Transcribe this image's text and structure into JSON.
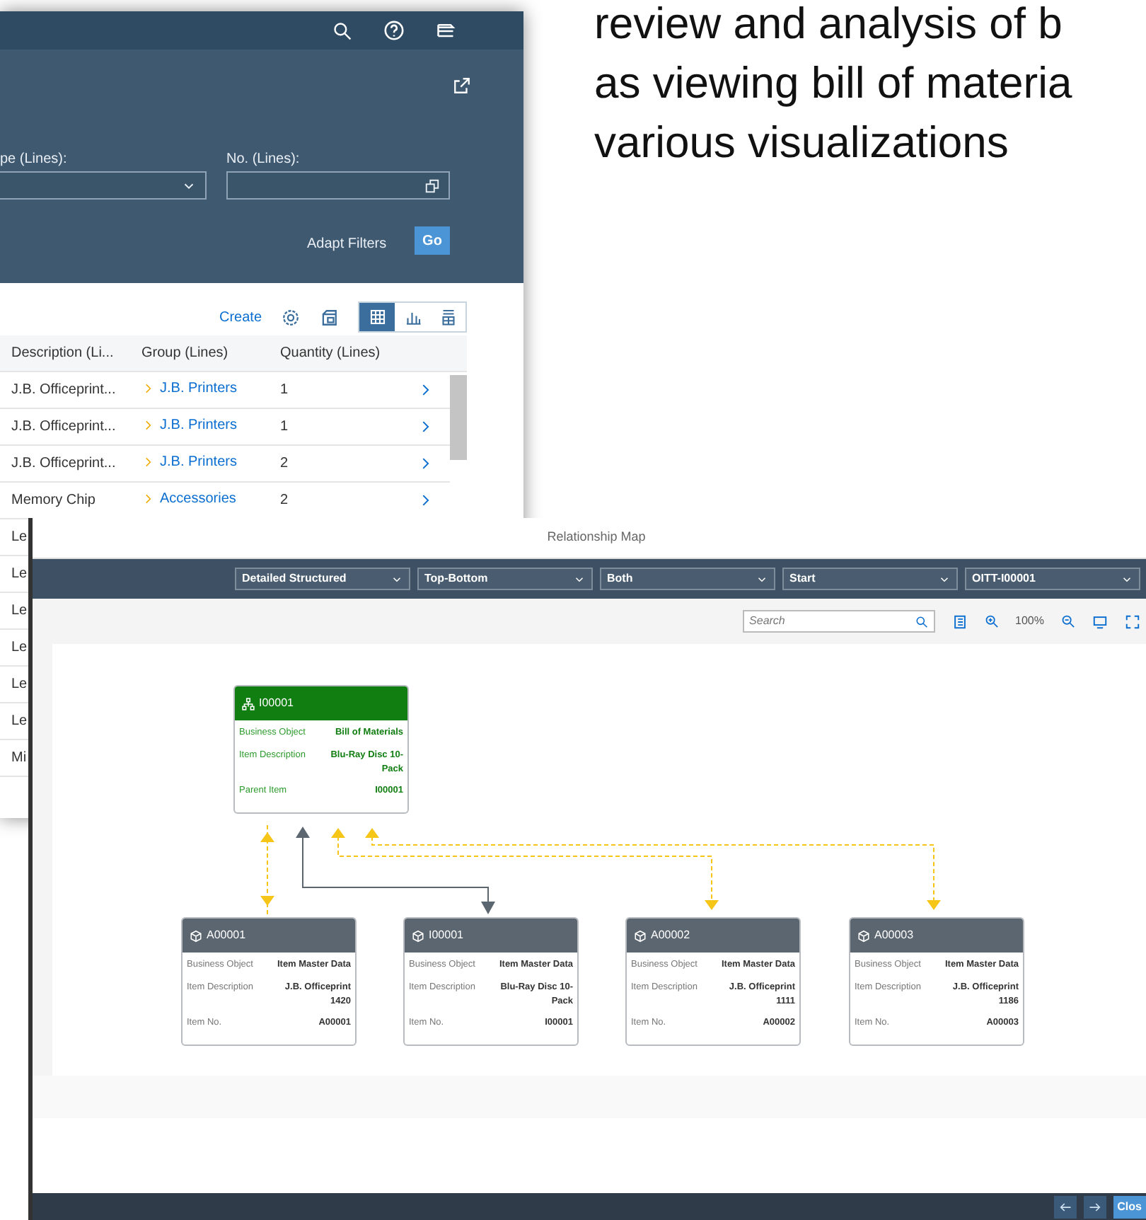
{
  "slide_text": [
    "review and analysis of b",
    "as viewing bill of materia",
    "various visualizations"
  ],
  "list_window": {
    "filters": [
      {
        "label": "pe (Lines):",
        "kind": "dropdown"
      },
      {
        "label": "No. (Lines):",
        "kind": "valuehelp"
      }
    ],
    "adapt_filters": "Adapt Filters",
    "go_button": "Go",
    "toolbar": {
      "create": "Create",
      "views": [
        {
          "kind": "table",
          "selected": true
        },
        {
          "kind": "chart",
          "selected": false
        },
        {
          "kind": "combined",
          "selected": false
        }
      ]
    },
    "table": {
      "columns": [
        "Description (Li...",
        "Group (Lines)",
        "Quantity (Lines)"
      ],
      "rows": [
        {
          "cells": [
            "J.B. Officeprint...",
            "J.B. Printers",
            "1"
          ]
        },
        {
          "cells": [
            "J.B. Officeprint...",
            "J.B. Printers",
            "1"
          ]
        },
        {
          "cells": [
            "J.B. Officeprint...",
            "J.B. Printers",
            "2"
          ]
        },
        {
          "cells": [
            "Memory Chip",
            "Accessories",
            "2"
          ]
        },
        {
          "cells": [
            "Le"
          ]
        },
        {
          "cells": [
            "Le"
          ]
        },
        {
          "cells": [
            "Le"
          ]
        },
        {
          "cells": [
            "Le"
          ]
        },
        {
          "cells": [
            "Le"
          ]
        },
        {
          "cells": [
            "Le"
          ]
        },
        {
          "cells": [
            "Mi"
          ]
        }
      ]
    }
  },
  "relationship_map": {
    "title": "Relationship Map",
    "dropdowns": [
      "Detailed Structured",
      "Top-Bottom",
      "Both",
      "Start",
      "OITT-I00001"
    ],
    "search": {
      "placeholder": "Search"
    },
    "zoom": "100%",
    "nodes": [
      {
        "kind": "bom",
        "title": "I00001",
        "fields": [
          {
            "label": "Business Object",
            "value": "Bill of Materials"
          },
          {
            "label": "Item Description",
            "value": "Blu-Ray Disc 10-Pack"
          },
          {
            "label": "Parent Item",
            "value": "I00001"
          }
        ]
      },
      {
        "kind": "item",
        "title": "A00001",
        "fields": [
          {
            "label": "Business Object",
            "value": "Item Master Data"
          },
          {
            "label": "Item Description",
            "value": "J.B. Officeprint 1420"
          },
          {
            "label": "Item No.",
            "value": "A00001"
          }
        ]
      },
      {
        "kind": "item",
        "title": "I00001",
        "fields": [
          {
            "label": "Business Object",
            "value": "Item Master Data"
          },
          {
            "label": "Item Description",
            "value": "Blu-Ray Disc 10-Pack"
          },
          {
            "label": "Item No.",
            "value": "I00001"
          }
        ]
      },
      {
        "kind": "item",
        "title": "A00002",
        "fields": [
          {
            "label": "Business Object",
            "value": "Item Master Data"
          },
          {
            "label": "Item Description",
            "value": "J.B. Officeprint 1111"
          },
          {
            "label": "Item No.",
            "value": "A00002"
          }
        ]
      },
      {
        "kind": "item",
        "title": "A00003",
        "fields": [
          {
            "label": "Business Object",
            "value": "Item Master Data"
          },
          {
            "label": "Item Description",
            "value": "J.B. Officeprint 1186"
          },
          {
            "label": "Item No.",
            "value": "A00003"
          }
        ]
      }
    ],
    "close_button": "Clos"
  }
}
